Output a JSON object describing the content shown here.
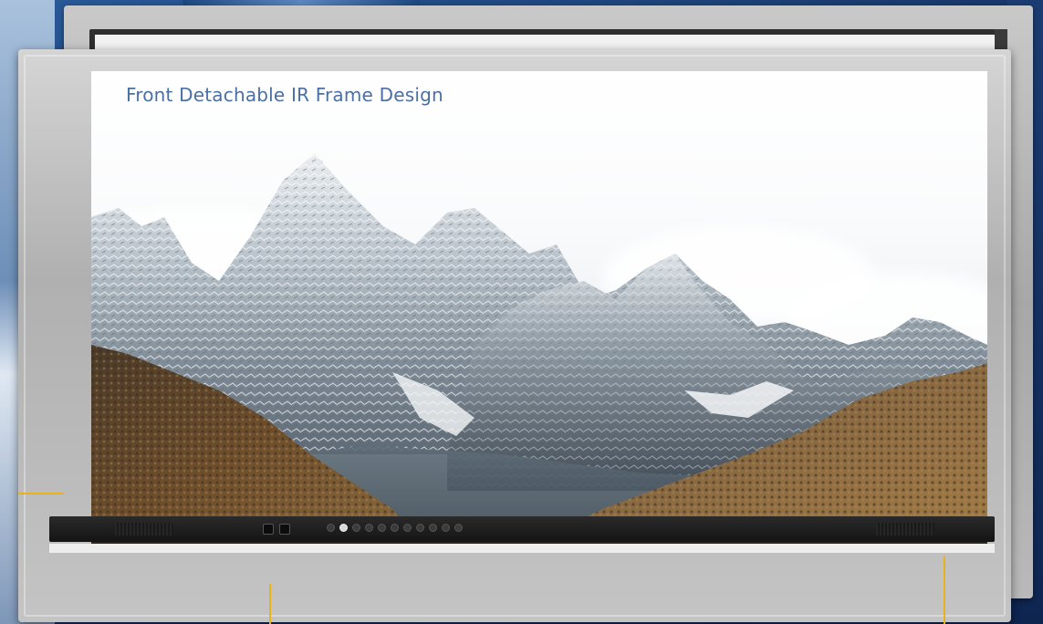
{
  "screen": {
    "title": "Front Detachable IR Frame Design"
  },
  "colors": {
    "title_text": "#4a6fa5",
    "frame_silver": "#b9b9b9",
    "bezel_black": "#161616",
    "callout_accent": "#e9b21c",
    "background_blue": "#163466"
  },
  "hardware": {
    "ports_count": 2,
    "front_buttons_count": 11
  }
}
